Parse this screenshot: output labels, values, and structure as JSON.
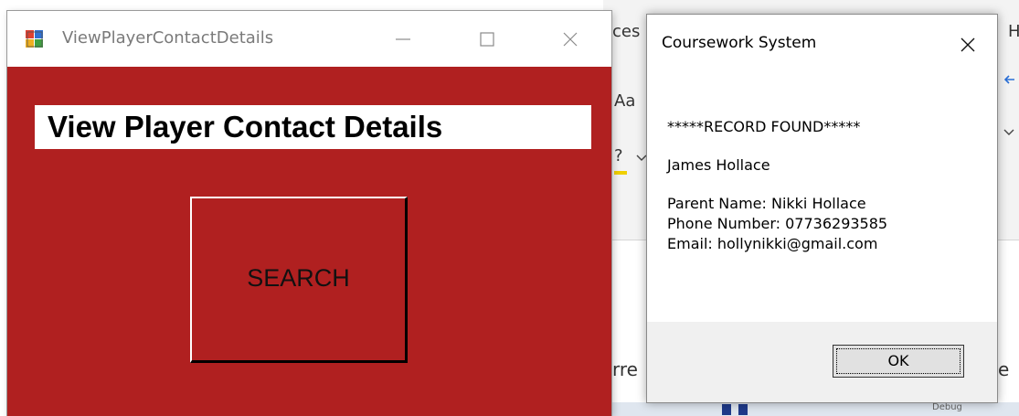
{
  "background_app": {
    "fragments": [
      "ces",
      "H",
      "Aa",
      "?",
      "rre",
      "e",
      "Debug"
    ]
  },
  "form_window": {
    "title": "ViewPlayerContactDetails",
    "heading": "View Player Contact Details",
    "search_button_label": "SEARCH",
    "background_color": "#b02020"
  },
  "message_box": {
    "title": "Coursework System",
    "lines": [
      "*****RECORD FOUND*****",
      "James Hollace",
      "Parent Name: Nikki Hollace",
      "Phone Number: 07736293585",
      "Email: hollynikki@gmail.com"
    ],
    "ok_label": "OK"
  },
  "icons": {
    "app": "winforms-app-icon",
    "minimize": "minimize-icon",
    "maximize": "maximize-icon",
    "close": "close-icon"
  }
}
